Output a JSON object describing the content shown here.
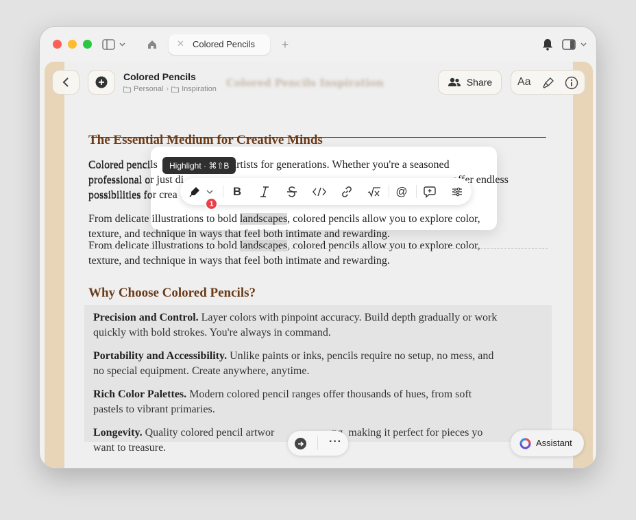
{
  "window": {
    "tab_title": "Colored Pencils"
  },
  "header": {
    "doc_title": "Colored Pencils",
    "breadcrumb": [
      "Personal",
      "Inspiration"
    ],
    "share_label": "Share",
    "font_button_label": "Aa",
    "ghost_title": "Colored Pencils Inspiration"
  },
  "document": {
    "section1_heading": "The Essential Medium for Creative Minds",
    "para1_line1_start": "Colored pencils",
    "para1_line1_end": "artists for generations. Whether you're a seasoned",
    "para1_line2_start": "professional or just di",
    "para1_line2_end": "offer endless",
    "para1_line3_start": "possibilities for crea",
    "para2_line1_before": "From delicate illustrations to bold ",
    "para2_highlighted": "landscapes",
    "para2_line1_after": ", colored pencils allow you to explore color,",
    "para2_line2": "texture, and technique in ways that feel both intimate and rewarding.",
    "section2_heading": "Why Choose Colored Pencils?",
    "benefits": [
      {
        "title": "Precision and Control.",
        "text_line1": " Layer colors with pinpoint accuracy. Build depth gradually or work",
        "text_line2": "quickly with bold strokes. You're always in command."
      },
      {
        "title": "Portability and Accessibility.",
        "text_line1": " Unlike paints or inks, pencils require no setup, no mess, and",
        "text_line2": "no special equipment. Create anywhere, anytime."
      },
      {
        "title": "Rich Color Palettes.",
        "text_line1": " Modern colored pencil ranges offer thousands of hues, from soft",
        "text_line2": "pastels to vibrant primaries."
      },
      {
        "title": "Longevity.",
        "text_line1": " Quality colored pencil artwor",
        "text_line1_end": "ng, making it perfect for pieces yo",
        "text_line2": "want to treasure."
      }
    ]
  },
  "format_toolbar": {
    "tooltip": "Highlight · ⌘⇧B",
    "badge_count": "1",
    "buttons": [
      "highlight-icon",
      "chevron-down-icon",
      "bold-icon",
      "italic-icon",
      "strikethrough-icon",
      "code-icon",
      "link-icon",
      "math-icon",
      "mention-icon",
      "comment-icon",
      "settings-icon"
    ]
  },
  "assistant": {
    "label": "Assistant"
  },
  "colors": {
    "heading": "#6b3b18",
    "content_border": "#e8d5b7",
    "badge": "#e8404b"
  }
}
